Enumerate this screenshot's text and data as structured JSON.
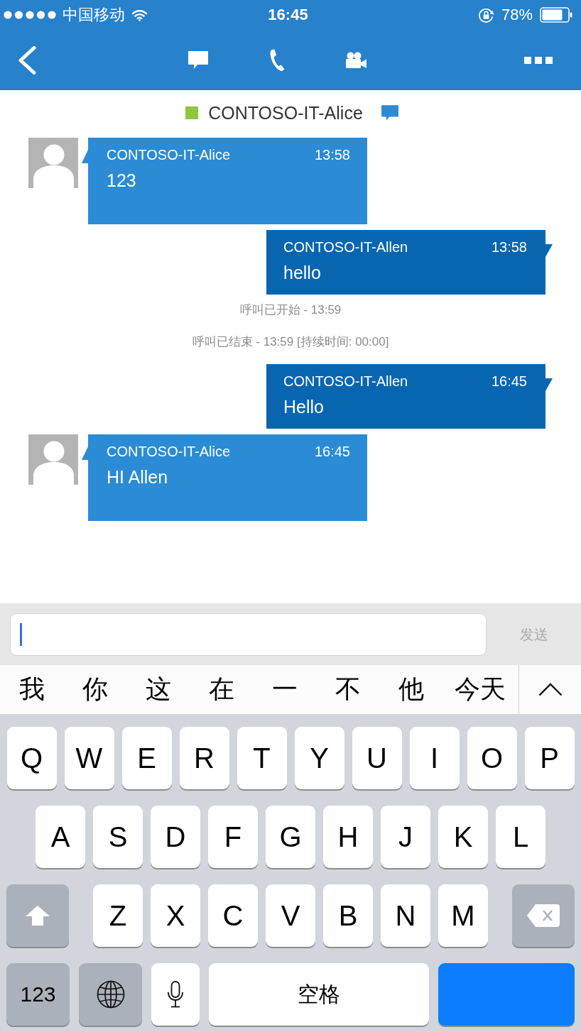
{
  "status_bar": {
    "carrier": "中国移动",
    "time": "16:45",
    "battery": "78%"
  },
  "contact": {
    "name": "CONTOSO-IT-Alice",
    "online": true
  },
  "messages": [
    {
      "kind": "incoming",
      "sender": "CONTOSO-IT-Alice",
      "time": "13:58",
      "text": "123"
    },
    {
      "kind": "outgoing",
      "sender": "CONTOSO-IT-Allen",
      "time": "13:58",
      "text": "hello"
    },
    {
      "kind": "system",
      "text": "呼叫已开始 - 13:59"
    },
    {
      "kind": "system",
      "text": "呼叫已结束 - 13:59 [持续时间: 00:00]"
    },
    {
      "kind": "outgoing",
      "sender": "CONTOSO-IT-Allen",
      "time": "16:45",
      "text": "Hello"
    },
    {
      "kind": "incoming",
      "sender": "CONTOSO-IT-Alice",
      "time": "16:45",
      "text": "HI Allen"
    }
  ],
  "composer": {
    "send": {
      "label": "发送",
      "disabled": true
    }
  },
  "candidates": [
    "我",
    "你",
    "这",
    "在",
    "一",
    "不",
    "他",
    "今天"
  ],
  "keyboard": {
    "letter_rows": [
      [
        "Q",
        "W",
        "E",
        "R",
        "T",
        "Y",
        "U",
        "I",
        "O",
        "P"
      ],
      [
        "A",
        "S",
        "D",
        "F",
        "G",
        "H",
        "J",
        "K",
        "L"
      ],
      [
        "Z",
        "X",
        "C",
        "V",
        "B",
        "N",
        "M"
      ]
    ],
    "numbers_key": "123",
    "space_key": "空格"
  }
}
